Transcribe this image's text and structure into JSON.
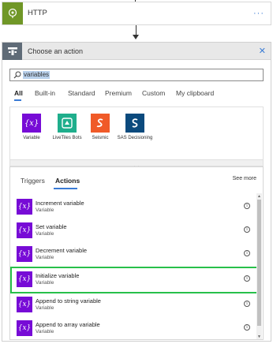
{
  "http_card": {
    "title": "HTTP",
    "more": "···",
    "accent": "#709727"
  },
  "panel": {
    "title": "Choose an action",
    "close": "✕",
    "search_value": "variables",
    "tabs": [
      "All",
      "Built-in",
      "Standard",
      "Premium",
      "Custom",
      "My clipboard"
    ],
    "active_tab": "All",
    "connectors": [
      {
        "label": "Variable",
        "color": "#770bd6",
        "icon": "variable-icon"
      },
      {
        "label": "LiveTiles Bots",
        "color": "#1fae8c",
        "icon": "livetiles-bots-icon"
      },
      {
        "label": "Seismic",
        "color": "#f05a28",
        "icon": "seismic-icon"
      },
      {
        "label": "SAS Decisioning",
        "color": "#0b4a7d",
        "icon": "sas-icon"
      }
    ],
    "subtabs": [
      "Triggers",
      "Actions"
    ],
    "active_subtab": "Actions",
    "see_more": "See more",
    "actions": [
      {
        "name": "Increment variable",
        "sub": "Variable"
      },
      {
        "name": "Set variable",
        "sub": "Variable"
      },
      {
        "name": "Decrement variable",
        "sub": "Variable"
      },
      {
        "name": "Initialize variable",
        "sub": "Variable"
      },
      {
        "name": "Append to string variable",
        "sub": "Variable"
      },
      {
        "name": "Append to array variable",
        "sub": "Variable"
      }
    ],
    "highlighted_action": "Initialize variable",
    "highlight_color": "#28c04a",
    "variable_glyph": "{x}"
  }
}
